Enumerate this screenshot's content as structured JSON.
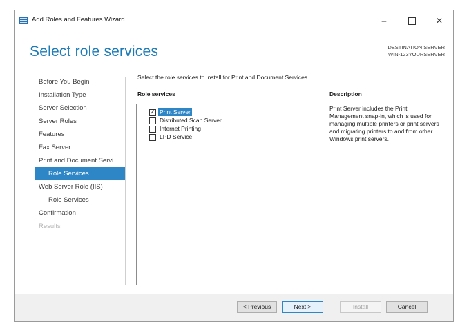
{
  "window": {
    "title": "Add Roles and Features Wizard",
    "controls": {
      "minimize": "–",
      "close": "✕"
    }
  },
  "header": {
    "page_title": "Select role services",
    "destination_label": "DESTINATION SERVER",
    "destination_server": "WIN-123YOURSERVER"
  },
  "nav": {
    "items": [
      {
        "label": "Before You Begin",
        "state": "normal"
      },
      {
        "label": "Installation Type",
        "state": "normal"
      },
      {
        "label": "Server Selection",
        "state": "normal"
      },
      {
        "label": "Server Roles",
        "state": "normal"
      },
      {
        "label": "Features",
        "state": "normal"
      },
      {
        "label": "Fax Server",
        "state": "normal"
      },
      {
        "label": "Print and Document Servi...",
        "state": "normal"
      },
      {
        "label": "Role Services",
        "state": "active"
      },
      {
        "label": "Web Server Role (IIS)",
        "state": "normal"
      },
      {
        "label": "Role Services",
        "state": "sub"
      },
      {
        "label": "Confirmation",
        "state": "normal"
      },
      {
        "label": "Results",
        "state": "disabled"
      }
    ]
  },
  "main": {
    "instruction": "Select the role services to install for Print and Document Services",
    "role_services_header": "Role services",
    "description_header": "Description",
    "roles": [
      {
        "label": "Print Server",
        "checked": true,
        "selected": true
      },
      {
        "label": "Distributed Scan Server",
        "checked": false,
        "selected": false
      },
      {
        "label": "Internet Printing",
        "checked": false,
        "selected": false
      },
      {
        "label": "LPD Service",
        "checked": false,
        "selected": false
      }
    ],
    "description": "Print Server includes the Print Management snap-in, which is used for managing multiple printers or print servers and migrating printers to and from other Windows print servers."
  },
  "footer": {
    "previous_prefix": "< ",
    "previous_accel": "P",
    "previous_rest": "revious",
    "next_accel": "N",
    "next_rest": "ext >",
    "install_accel": "I",
    "install_rest": "nstall",
    "cancel": "Cancel"
  },
  "colors": {
    "accent": "#2f86c6",
    "title_blue": "#1b7ab8"
  }
}
